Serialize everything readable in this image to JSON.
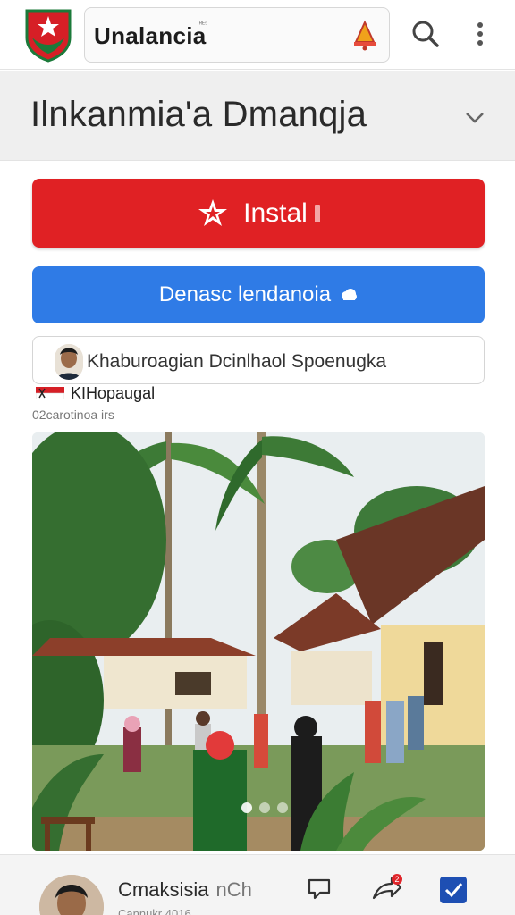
{
  "topbar": {
    "site_title": "Unalancia",
    "site_tag": "ᴿᴱ⁵"
  },
  "header": {
    "title": "Ilnkanmia'a Dmanqja"
  },
  "actions": {
    "install_label": "Instal",
    "download_label": "Denasc lendanoia"
  },
  "user_row": {
    "text": "Khaburoagian Dcinlhaol Spoenugka"
  },
  "post": {
    "author": "KIHopaugal",
    "date": "02carotinoa irs"
  },
  "gallery": {
    "dots": 3,
    "active_index": 0
  },
  "bottom": {
    "user_name": "Cmaksisia",
    "user_tag": "nCh",
    "sub_text": "Cannukr 4016",
    "notification_count": "2"
  },
  "colors": {
    "install": "#e02124",
    "download": "#2f7be6",
    "header_bg": "#efefef"
  }
}
